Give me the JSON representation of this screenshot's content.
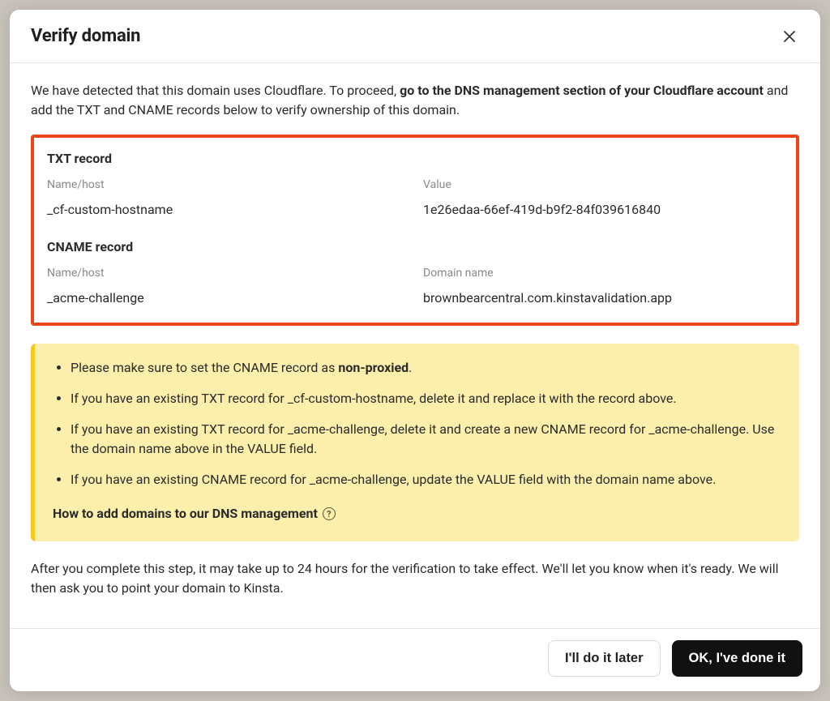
{
  "modal": {
    "title": "Verify domain",
    "intro_prefix": "We have detected that this domain uses Cloudflare. To proceed, ",
    "intro_bold": "go to the DNS management section of your Cloudflare account",
    "intro_suffix": " and add the TXT and CNAME records below to verify ownership of this domain.",
    "txt": {
      "heading": "TXT record",
      "name_label": "Name/host",
      "name_value": "_cf-custom-hostname",
      "value_label": "Value",
      "value_value": "1e26edaa-66ef-419d-b9f2-84f039616840"
    },
    "cname": {
      "heading": "CNAME record",
      "name_label": "Name/host",
      "name_value": "_acme-challenge",
      "domain_label": "Domain name",
      "domain_value": "brownbearcentral.com.kinstavalidation.app"
    },
    "notes": {
      "item1_prefix": "Please make sure to set the CNAME record as ",
      "item1_bold": "non-proxied",
      "item1_suffix": ".",
      "item2": "If you have an existing TXT record for _cf-custom-hostname, delete it and replace it with the record above.",
      "item3": "If you have an existing TXT record for _acme-challenge, delete it and create a new CNAME record for _acme-challenge. Use the domain name above in the VALUE field.",
      "item4": "If you have an existing CNAME record for _acme-challenge, update the VALUE field with the domain name above.",
      "help_link": "How to add domains to our DNS management"
    },
    "after": "After you complete this step, it may take up to 24 hours for the verification to take effect. We'll let you know when it's ready. We will then ask you to point your domain to Kinsta.",
    "buttons": {
      "later": "I'll do it later",
      "done": "OK, I've done it"
    }
  }
}
